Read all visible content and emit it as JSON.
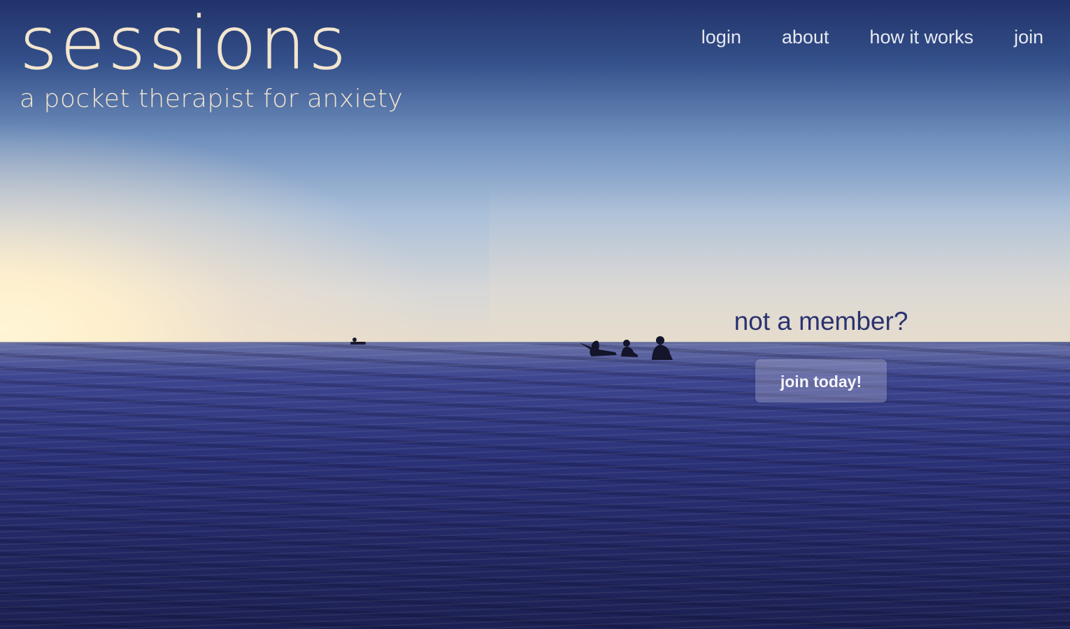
{
  "brand": {
    "title": "sessions",
    "tagline": "a pocket therapist for anxiety"
  },
  "nav": {
    "items": [
      {
        "label": "login"
      },
      {
        "label": "about"
      },
      {
        "label": "how it works"
      },
      {
        "label": "join"
      }
    ]
  },
  "cta": {
    "heading": "not a member?",
    "button_label": "join today!"
  },
  "colors": {
    "logo": "#f3e6cf",
    "nav_text": "#e6e9f2",
    "cta_heading": "#2a3270",
    "sea_dark": "#1c2052",
    "sky_top": "#22326a"
  },
  "background_image": "ocean-horizon-with-surfers-silhouettes"
}
